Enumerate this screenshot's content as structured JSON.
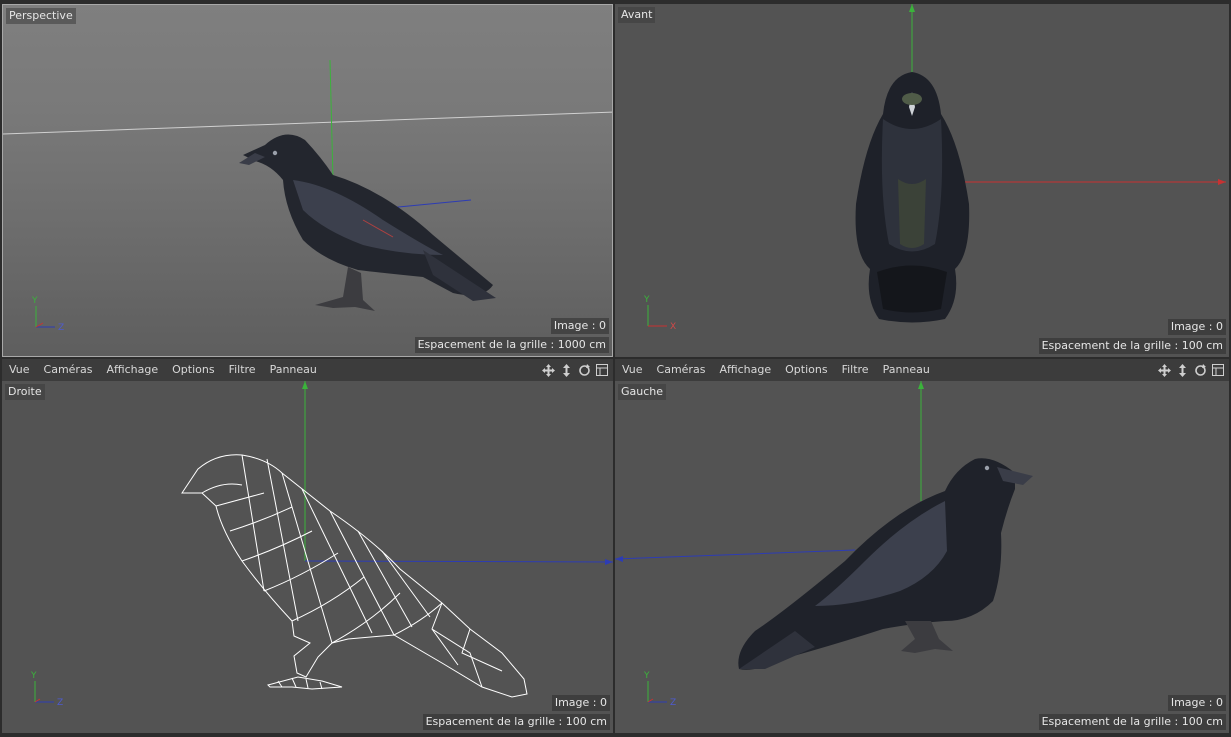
{
  "viewports": {
    "perspective": {
      "label": "Perspective",
      "frame": "Image : 0",
      "grid": "Espacement de la grille : 1000 cm",
      "axis_labels": {
        "y": "Y",
        "second": "Z"
      }
    },
    "avant": {
      "label": "Avant",
      "frame": "Image : 0",
      "grid": "Espacement de la grille : 100 cm",
      "axis_labels": {
        "y": "Y",
        "second": "X"
      }
    },
    "droite": {
      "label": "Droite",
      "frame": "Image : 0",
      "grid": "Espacement de la grille : 100 cm",
      "axis_labels": {
        "y": "Y",
        "second": "Z"
      }
    },
    "gauche": {
      "label": "Gauche",
      "frame": "Image : 0",
      "grid": "Espacement de la grille : 100 cm",
      "axis_labels": {
        "y": "Y",
        "second": "Z"
      }
    }
  },
  "menu": {
    "left": [
      "Vue",
      "Caméras",
      "Affichage",
      "Options",
      "Filtre",
      "Panneau"
    ],
    "right": [
      "Vue",
      "Caméras",
      "Affichage",
      "Options",
      "Filtre",
      "Panneau"
    ]
  },
  "nav_icons": [
    "move-view-icon",
    "dolly-view-icon",
    "rotate-view-icon",
    "toggle-layout-icon"
  ],
  "colors": {
    "axis_x": "#c83232",
    "axis_y": "#33c033",
    "axis_z": "#2d3cb4",
    "viewport_bg": "#535353",
    "menubar_bg": "#3c3c3c"
  }
}
